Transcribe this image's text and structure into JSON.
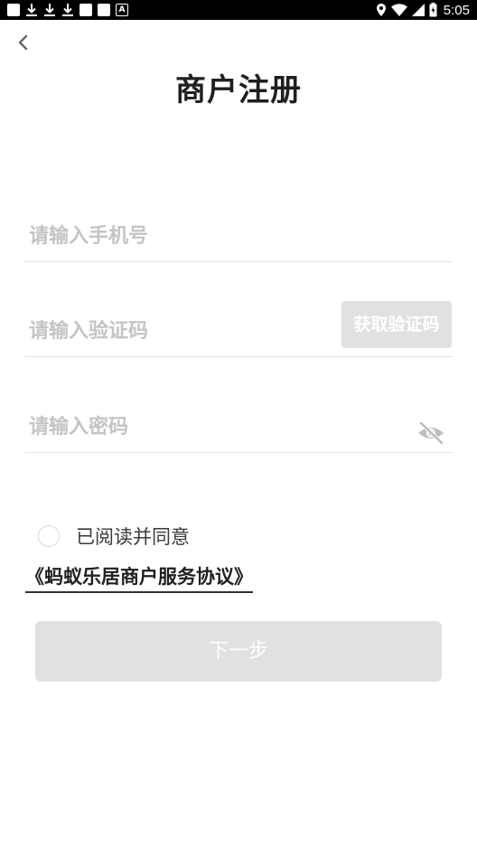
{
  "status_bar": {
    "time": "5:05",
    "left_icons": [
      "notification-square-icon",
      "download-icon",
      "download-icon",
      "download-icon",
      "notification-square-icon",
      "notification-square-icon",
      "a-box-icon"
    ],
    "right_icons": [
      "location-icon",
      "wifi-icon",
      "signal-icon",
      "battery-icon"
    ]
  },
  "header": {
    "back_icon": "chevron-left-icon",
    "title": "商户注册"
  },
  "form": {
    "phone": {
      "placeholder": "请输入手机号",
      "value": ""
    },
    "code": {
      "placeholder": "请输入验证码",
      "value": "",
      "button_label": "获取验证码"
    },
    "password": {
      "placeholder": "请输入密码",
      "value": "",
      "toggle_icon": "eye-off-icon"
    }
  },
  "agreement": {
    "checked": false,
    "label": "已阅读并同意",
    "link_text": "《蚂蚁乐居商户服务协议》"
  },
  "actions": {
    "next_label": "下一步"
  },
  "colors": {
    "status_bar": "#000000",
    "title": "#1f1f1f",
    "placeholder": "#c4c4c4",
    "disabled_button": "#e1e1e1",
    "divider": "#e3e3e3"
  }
}
